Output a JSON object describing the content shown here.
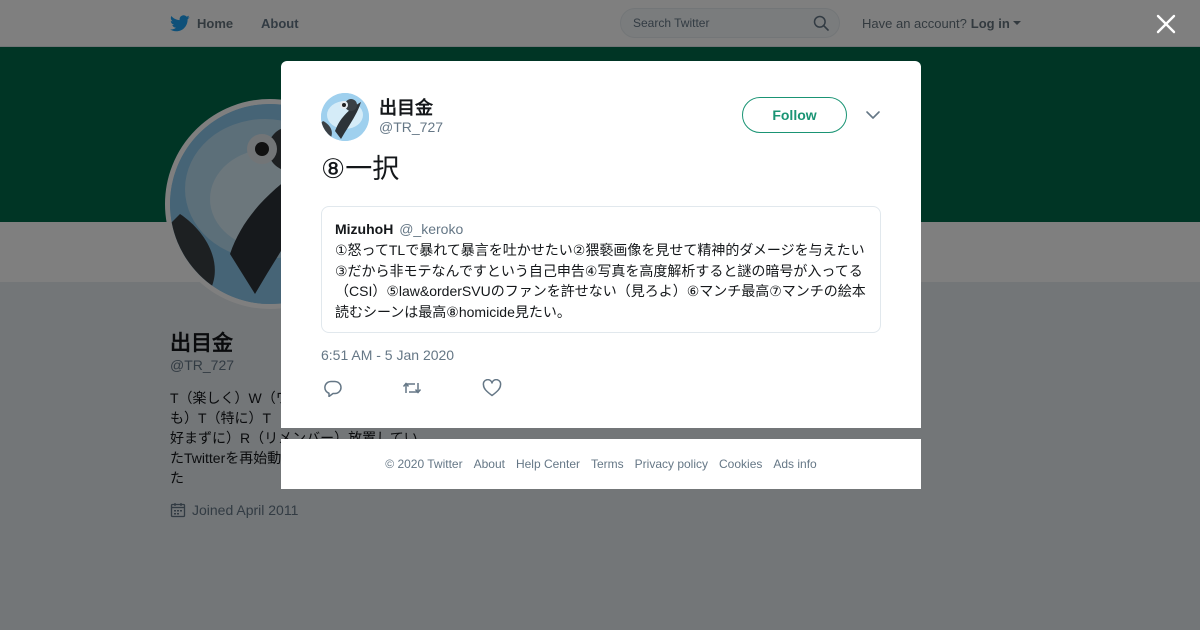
{
  "nav": {
    "home_label": "Home",
    "about_label": "About",
    "search_placeholder": "Search Twitter",
    "account_prompt": "Have an account?",
    "login_label": "Log in",
    "brand_color": "#1da1f2"
  },
  "profile": {
    "banner_color": "#006a4a",
    "name": "出目金",
    "handle": "@TR_727",
    "bio": "T（楽しく）W（ワ）I（い）T（と）T（ついても）E（え）R（り）T（特に）T（と）E（え）好まずに）R（リメンバー）放置していたTwitterを再始動し",
    "bio_visible": "T（楽しく）W（ワ\nも）T（特に）T\n好まずに）R（リメンバー）放置してい\nたTwitterを再始動\nた",
    "joined": "Joined April 2011"
  },
  "tweet": {
    "author_name": "出目金",
    "author_handle": "@TR_727",
    "follow_label": "Follow",
    "text": "⑧一択",
    "quote": {
      "name": "MizuhoH",
      "handle": "@_keroko",
      "text": "①怒ってTLで暴れて暴言を吐かせたい②猥褻画像を見せて精神的ダメージを与えたい③だから非モテなんですという自己申告④写真を高度解析すると謎の暗号が入ってる（CSI）⑤law&orderSVUのファンを許せない（見ろよ）⑥マンチ最高⑦マンチの絵本読むシーンは最高⑧homicide見たい。"
    },
    "timestamp": "6:51 AM - 5 Jan 2020",
    "accent_color": "#1a9474"
  },
  "footer": {
    "copyright": "© 2020 Twitter",
    "links": [
      "About",
      "Help Center",
      "Terms",
      "Privacy policy",
      "Cookies",
      "Ads info"
    ]
  }
}
